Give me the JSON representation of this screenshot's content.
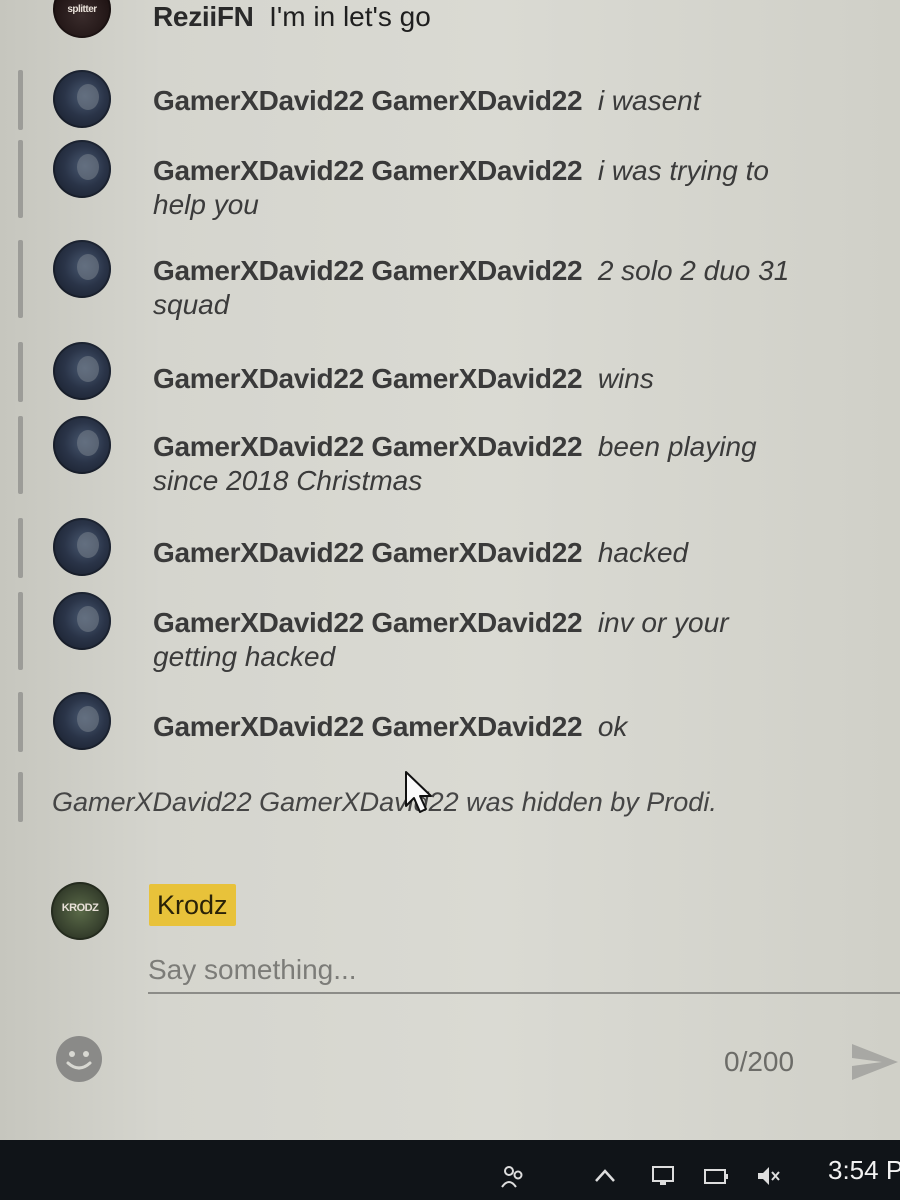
{
  "chat": {
    "top_message": {
      "author": "ReziiFN",
      "text": "I'm in let's go",
      "avatar_text": "splitter"
    },
    "messages": [
      {
        "author": "GamerXDavid22 GamerXDavid22",
        "text": "i wasent",
        "cont": ""
      },
      {
        "author": "GamerXDavid22 GamerXDavid22",
        "text": "i was trying to",
        "cont": "help you"
      },
      {
        "author": "GamerXDavid22 GamerXDavid22",
        "text": "2 solo 2 duo 31",
        "cont": "squad"
      },
      {
        "author": "GamerXDavid22 GamerXDavid22",
        "text": "wins",
        "cont": ""
      },
      {
        "author": "GamerXDavid22 GamerXDavid22",
        "text": "been playing",
        "cont": "since 2018 Christmas"
      },
      {
        "author": "GamerXDavid22 GamerXDavid22",
        "text": "hacked",
        "cont": ""
      },
      {
        "author": "GamerXDavid22 GamerXDavid22",
        "text": "inv or your",
        "cont": "getting hacked"
      },
      {
        "author": "GamerXDavid22 GamerXDavid22",
        "text": "ok",
        "cont": ""
      }
    ],
    "hidden_notice": "GamerXDavid22 GamerXDavid22 was hidden by Prodi."
  },
  "input": {
    "channel_name": "Krodz",
    "avatar_text": "KRODZ",
    "placeholder": "Say something...",
    "char_count": "0/200"
  },
  "taskbar": {
    "clock": "3:54 P"
  },
  "colors": {
    "channel_badge": "#e8c23a",
    "held_bar": "#9c9c98",
    "taskbar_bg": "#101418"
  }
}
